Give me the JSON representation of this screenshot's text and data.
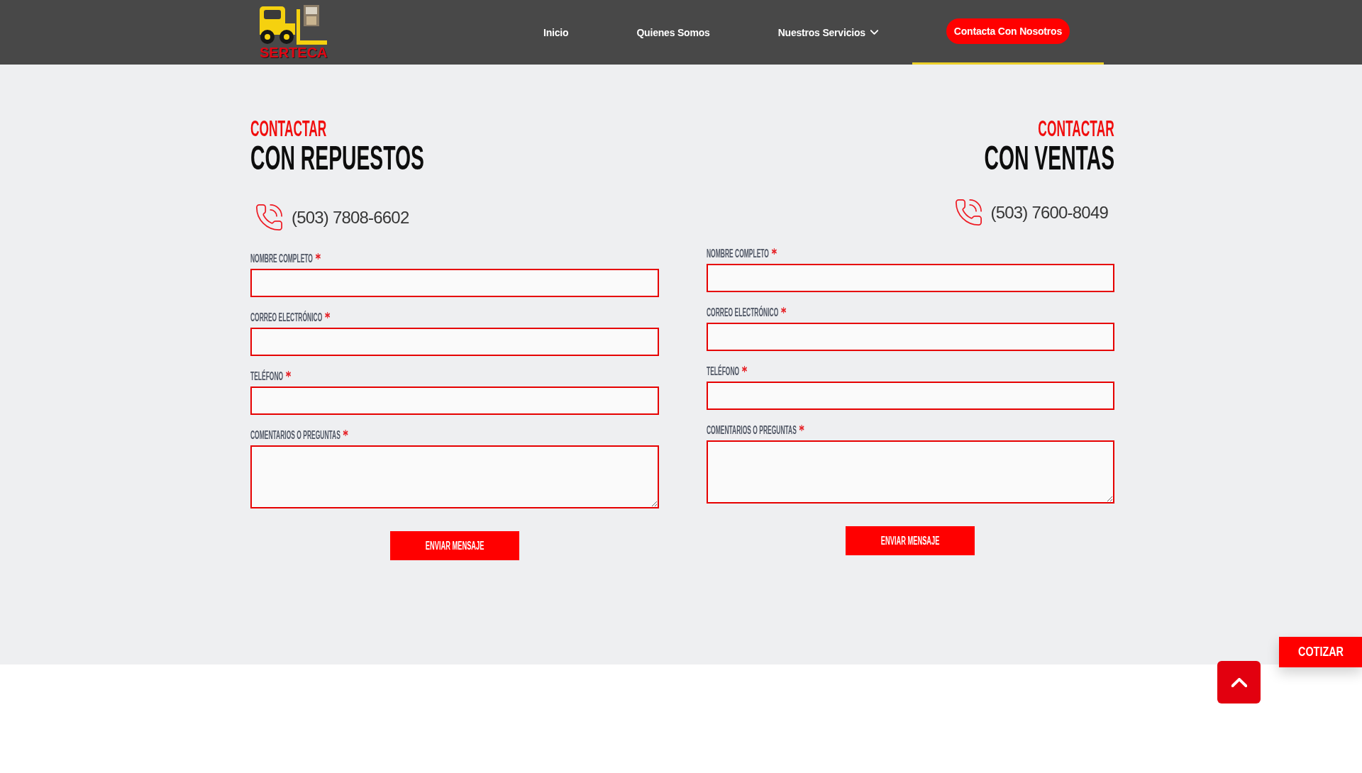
{
  "header": {
    "logo": {
      "text": "SERTECA"
    },
    "nav": [
      {
        "label": "Inicio",
        "kind": "link",
        "selected": false
      },
      {
        "label": "Quienes Somos",
        "kind": "link",
        "selected": false
      },
      {
        "label": "Nuestros Servicios",
        "kind": "dropdown",
        "selected": false
      },
      {
        "label": "Contacta Con Nosotros",
        "kind": "button",
        "selected": true
      }
    ]
  },
  "contact_forms": [
    {
      "aligned_right": false,
      "eyebrow": "CONTACTAR",
      "title": "CON REPUESTOS",
      "phone": "(503) 7808-6602",
      "fields": [
        {
          "label": "NOMBRE COMPLETO",
          "kind": "input",
          "required": true
        },
        {
          "label": "CORREO ELECTRÓNICO",
          "kind": "input",
          "required": true
        },
        {
          "label": "TELÉFONO",
          "kind": "input",
          "required": true
        },
        {
          "label": "COMENTARIOS O PREGUNTAS",
          "kind": "textarea",
          "required": true
        }
      ],
      "submit": "ENVIAR MENSAJE"
    },
    {
      "aligned_right": true,
      "eyebrow": "CONTACTAR",
      "title": "CON VENTAS",
      "phone": "(503) 7600-8049",
      "fields": [
        {
          "label": "NOMBRE COMPLETO",
          "kind": "input",
          "required": true
        },
        {
          "label": "CORREO ELECTRÓNICO",
          "kind": "input",
          "required": true
        },
        {
          "label": "TELÉFONO",
          "kind": "input",
          "required": true
        },
        {
          "label": "COMENTARIOS O PREGUNTAS",
          "kind": "textarea",
          "required": true
        }
      ],
      "submit": "ENVIAR MENSAJE"
    }
  ],
  "quote_tab": {
    "label": "COTIZAR"
  }
}
